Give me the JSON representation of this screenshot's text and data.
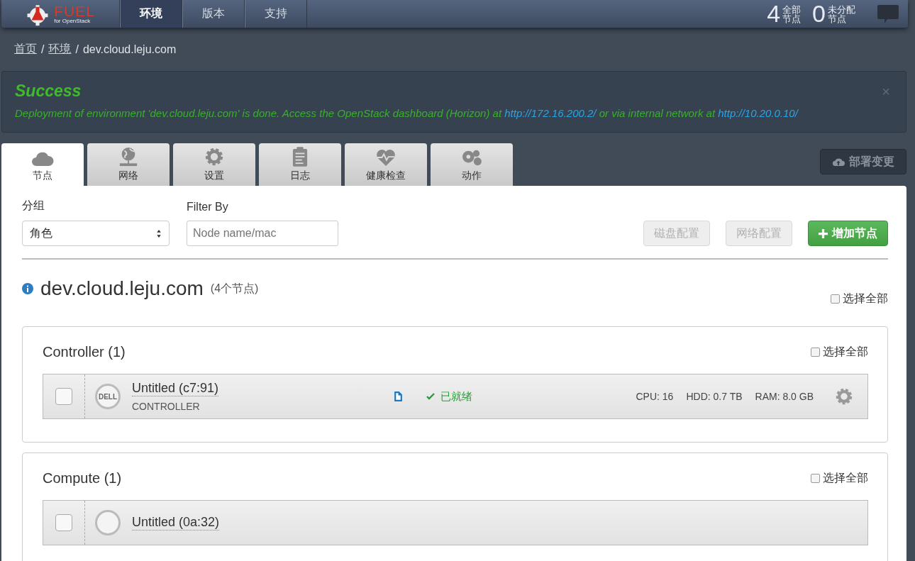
{
  "brand": {
    "name": "FUEL",
    "subtitle": "for OpenStack"
  },
  "nav": [
    {
      "label": "环境",
      "selected": true
    },
    {
      "label": "版本",
      "selected": false
    },
    {
      "label": "支持",
      "selected": false
    }
  ],
  "stats": [
    {
      "count": "4",
      "line1": "全部",
      "line2": "节点"
    },
    {
      "count": "0",
      "line1": "未分配",
      "line2": "节点"
    }
  ],
  "breadcrumb": [
    {
      "label": "首页",
      "link": true,
      "separator": "/"
    },
    {
      "label": "环境",
      "link": true,
      "separator": "/"
    },
    {
      "label": "dev.cloud.leju.com",
      "link": false
    }
  ],
  "alert": {
    "title": "Success",
    "close": "×",
    "parts": [
      {
        "text": "Deployment of environment 'dev.cloud.leju.com' is done. Access the OpenStack dashboard (Horizon) at ",
        "link": false
      },
      {
        "text": "http://172.16.200.2/",
        "link": true
      },
      {
        "text": " or via internal network at ",
        "link": false
      },
      {
        "text": "http://10.20.0.10/",
        "link": true
      }
    ]
  },
  "tabs": [
    {
      "label": "节点",
      "selected": true
    },
    {
      "label": "网络",
      "selected": false
    },
    {
      "label": "设置",
      "selected": false
    },
    {
      "label": "日志",
      "selected": false
    },
    {
      "label": "健康检查",
      "selected": false
    },
    {
      "label": "动作",
      "selected": false
    }
  ],
  "deploy_button": {
    "label": "部署变更"
  },
  "toolbar": {
    "group_label": "分组",
    "group_value": "角色",
    "filter_label": "Filter By",
    "filter_placeholder": "Node name/mac",
    "buttons": [
      {
        "label": "磁盘配置",
        "kind": "default",
        "disabled": true
      },
      {
        "label": "网络配置",
        "kind": "default",
        "disabled": true
      },
      {
        "label": "增加节点",
        "kind": "primary",
        "disabled": false
      }
    ]
  },
  "environment": {
    "name": "dev.cloud.leju.com",
    "count": "(4个节点)",
    "select_all": {
      "label": "选择全部",
      "checked": false
    }
  },
  "groups": [
    {
      "title": "Controller (1)",
      "select_all": {
        "label": "选择全部",
        "checked": false
      },
      "nodes": [
        {
          "checked": false,
          "vendor": "DELL",
          "name": "Untitled (c7:91)",
          "role": "CONTROLLER",
          "status": "已就绪",
          "cpu": "CPU: 16",
          "hdd": "HDD: 0.7 TB",
          "ram": "RAM: 8.0 GB"
        }
      ]
    },
    {
      "title": "Compute (1)",
      "select_all": {
        "label": "选择全部",
        "checked": false
      },
      "nodes": [
        {
          "checked": false,
          "name": "Untitled (0a:32)"
        }
      ]
    }
  ]
}
